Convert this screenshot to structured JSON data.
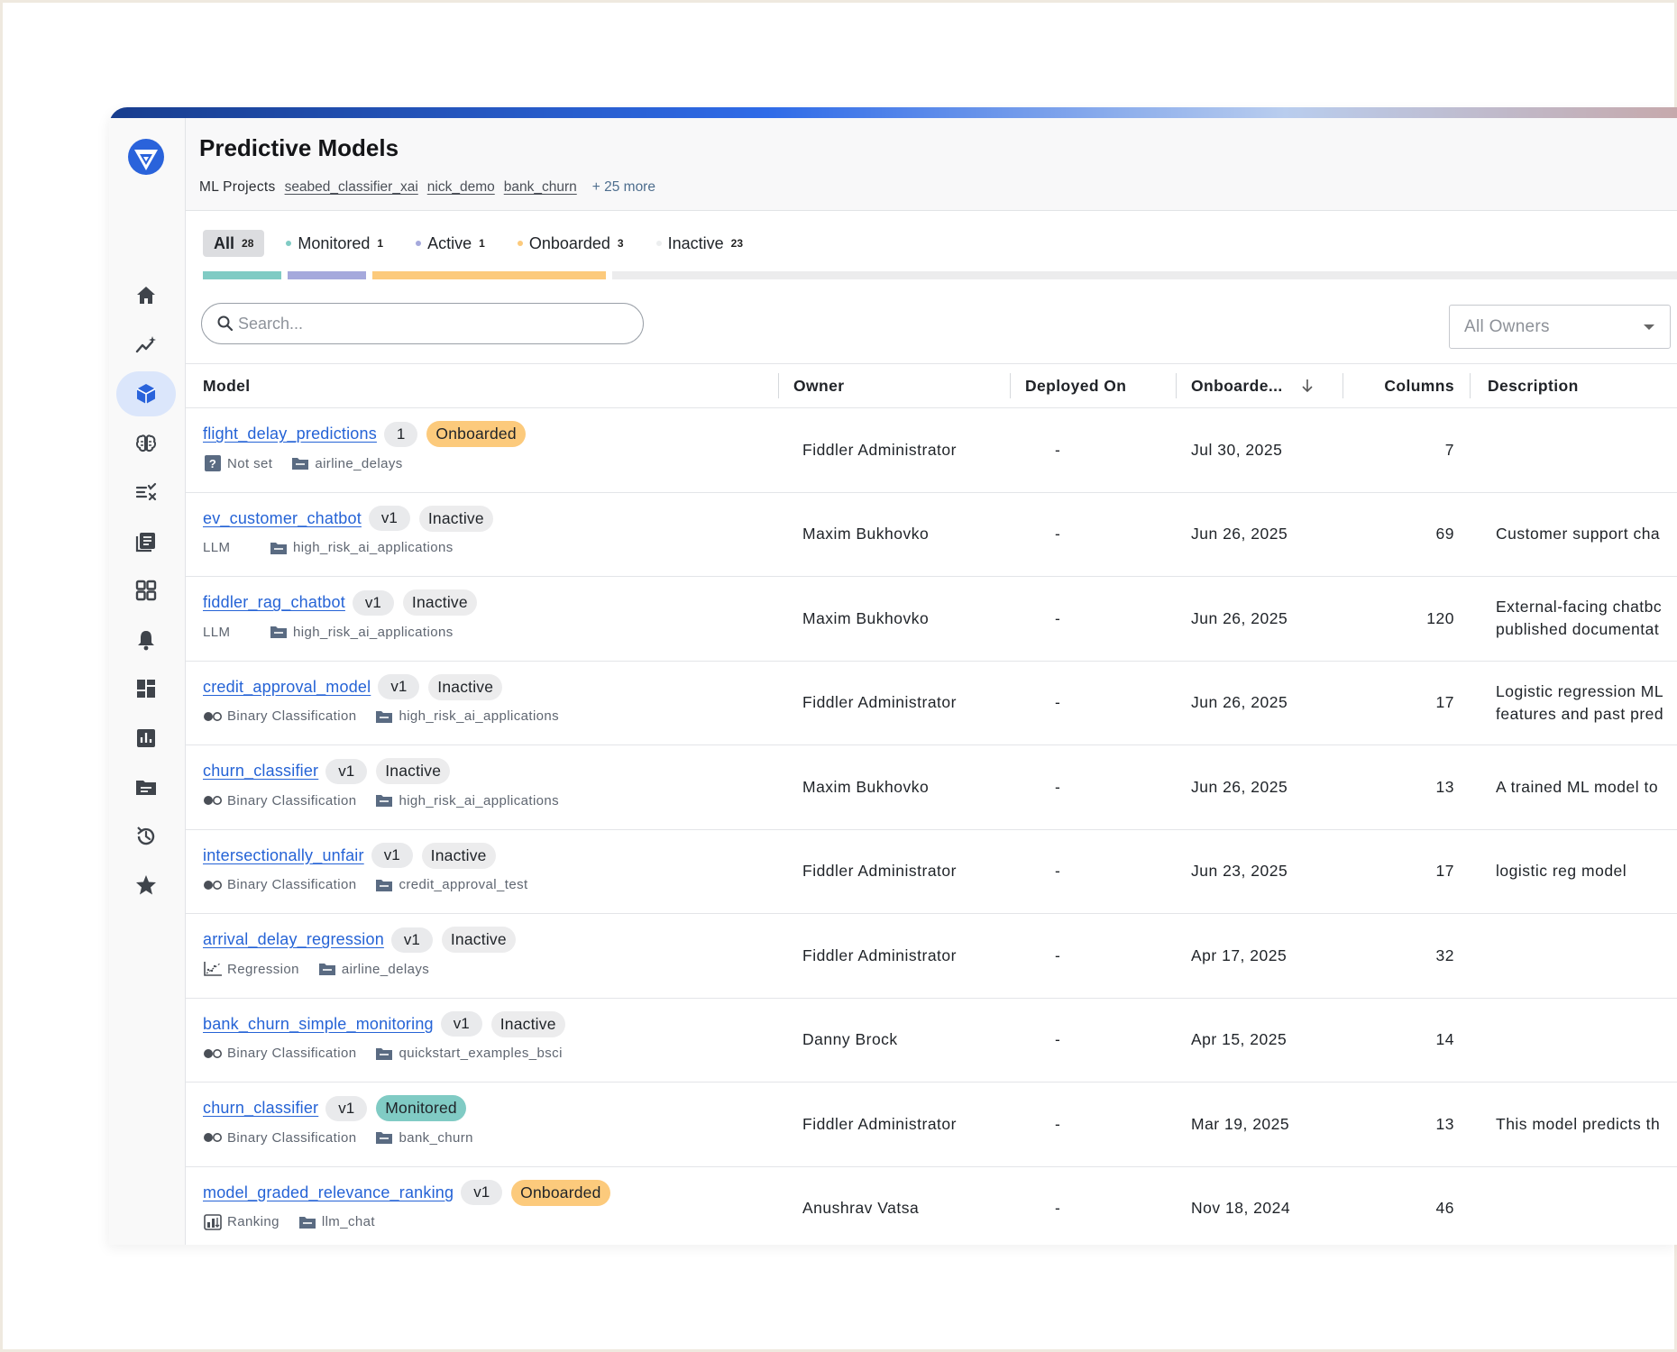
{
  "app": {
    "title": "Predictive Models"
  },
  "colors": {
    "brand": "#2a63db",
    "link": "#2563d6",
    "onboarded": "#fcca7c",
    "monitored": "#80cbc4",
    "active": "#a5a9dc",
    "inactive_pill": "#ececed"
  },
  "sidebar": {
    "items": [
      {
        "name": "home-icon",
        "active": false
      },
      {
        "name": "insights-icon",
        "active": false
      },
      {
        "name": "models-cube-icon",
        "active": true
      },
      {
        "name": "brain-icon",
        "active": false
      },
      {
        "name": "rules-icon",
        "active": false
      },
      {
        "name": "docs-icon",
        "active": false
      },
      {
        "name": "apps-grid-icon",
        "active": false
      },
      {
        "name": "bell-icon",
        "active": false
      },
      {
        "name": "dashboard-icon",
        "active": false
      },
      {
        "name": "chart-icon",
        "active": false
      },
      {
        "name": "folder-icon",
        "active": false
      },
      {
        "name": "history-icon",
        "active": false
      },
      {
        "name": "star-icon",
        "active": false
      }
    ]
  },
  "header": {
    "projects_label": "ML Projects",
    "projects": [
      "seabed_classifier_xai",
      "nick_demo",
      "bank_churn"
    ],
    "more": "+ 25 more"
  },
  "tabs": [
    {
      "label": "All",
      "count": "28",
      "dot": ""
    },
    {
      "label": "Monitored",
      "count": "1",
      "dot": "#80cbc4"
    },
    {
      "label": "Active",
      "count": "1",
      "dot": "#a5a9dc"
    },
    {
      "label": "Onboarded",
      "count": "3",
      "dot": "#fcca7c"
    },
    {
      "label": "Inactive",
      "count": "23",
      "dot": "#eceeef"
    }
  ],
  "progress": [
    {
      "label": "Monitored",
      "color": "#80cbc4",
      "fraction": 0.036
    },
    {
      "label": "Active",
      "color": "#a5a9dc",
      "fraction": 0.036
    },
    {
      "label": "Onboarded",
      "color": "#fcca7c",
      "fraction": 0.107
    },
    {
      "label": "Inactive",
      "color": "#ececed",
      "fraction": 0.821
    }
  ],
  "search": {
    "placeholder": "Search..."
  },
  "owner_filter": {
    "value": "All Owners"
  },
  "table": {
    "headers": {
      "model": "Model",
      "owner": "Owner",
      "deployed": "Deployed On",
      "onboarded": "Onboarde...",
      "columns": "Columns",
      "description": "Description"
    },
    "rows": [
      {
        "name": "flight_delay_predictions",
        "version": "1",
        "status": "Onboarded",
        "task": "Not set",
        "task_icon": "question-icon",
        "project": "airline_delays",
        "owner": "Fiddler Administrator",
        "deployed": "-",
        "onboarded": "Jul 30, 2025",
        "columns": "7",
        "description": ""
      },
      {
        "name": "ev_customer_chatbot",
        "version": "v1",
        "status": "Inactive",
        "task": "LLM",
        "task_icon": "",
        "project": "high_risk_ai_applications",
        "owner": "Maxim Bukhovko",
        "deployed": "-",
        "onboarded": "Jun 26, 2025",
        "columns": "69",
        "description": "Customer support cha"
      },
      {
        "name": "fiddler_rag_chatbot",
        "version": "v1",
        "status": "Inactive",
        "task": "LLM",
        "task_icon": "",
        "project": "high_risk_ai_applications",
        "owner": "Maxim Bukhovko",
        "deployed": "-",
        "onboarded": "Jun 26, 2025",
        "columns": "120",
        "description": "External-facing chatbc published documentat"
      },
      {
        "name": "credit_approval_model",
        "version": "v1",
        "status": "Inactive",
        "task": "Binary Classification",
        "task_icon": "binary-icon",
        "project": "high_risk_ai_applications",
        "owner": "Fiddler Administrator",
        "deployed": "-",
        "onboarded": "Jun 26, 2025",
        "columns": "17",
        "description": "Logistic regression ML features and past pred"
      },
      {
        "name": "churn_classifier",
        "version": "v1",
        "status": "Inactive",
        "task": "Binary Classification",
        "task_icon": "binary-icon",
        "project": "high_risk_ai_applications",
        "owner": "Maxim Bukhovko",
        "deployed": "-",
        "onboarded": "Jun 26, 2025",
        "columns": "13",
        "description": "A trained ML model to"
      },
      {
        "name": "intersectionally_unfair",
        "version": "v1",
        "status": "Inactive",
        "task": "Binary Classification",
        "task_icon": "binary-icon",
        "project": "credit_approval_test",
        "owner": "Fiddler Administrator",
        "deployed": "-",
        "onboarded": "Jun 23, 2025",
        "columns": "17",
        "description": "logistic reg model"
      },
      {
        "name": "arrival_delay_regression",
        "version": "v1",
        "status": "Inactive",
        "task": "Regression",
        "task_icon": "regression-icon",
        "project": "airline_delays",
        "owner": "Fiddler Administrator",
        "deployed": "-",
        "onboarded": "Apr 17, 2025",
        "columns": "32",
        "description": ""
      },
      {
        "name": "bank_churn_simple_monitoring",
        "version": "v1",
        "status": "Inactive",
        "task": "Binary Classification",
        "task_icon": "binary-icon",
        "project": "quickstart_examples_bsci",
        "owner": "Danny Brock",
        "deployed": "-",
        "onboarded": "Apr 15, 2025",
        "columns": "14",
        "description": ""
      },
      {
        "name": "churn_classifier",
        "version": "v1",
        "status": "Monitored",
        "task": "Binary Classification",
        "task_icon": "binary-icon",
        "project": "bank_churn",
        "owner": "Fiddler Administrator",
        "deployed": "-",
        "onboarded": "Mar 19, 2025",
        "columns": "13",
        "description": "This model predicts th"
      },
      {
        "name": "model_graded_relevance_ranking",
        "version": "v1",
        "status": "Onboarded",
        "task": "Ranking",
        "task_icon": "ranking-icon",
        "project": "llm_chat",
        "owner": "Anushrav Vatsa",
        "deployed": "-",
        "onboarded": "Nov 18, 2024",
        "columns": "46",
        "description": ""
      }
    ]
  }
}
